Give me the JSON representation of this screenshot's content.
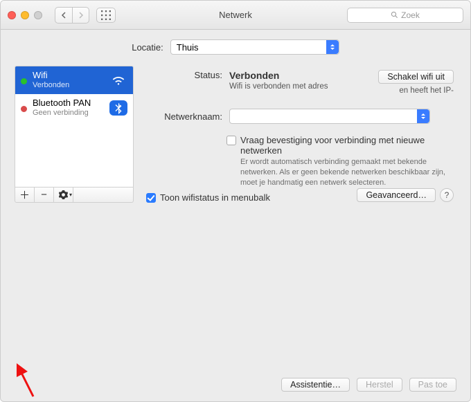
{
  "window": {
    "title": "Netwerk"
  },
  "search": {
    "placeholder": "Zoek"
  },
  "location": {
    "label": "Locatie:",
    "value": "Thuis"
  },
  "services": [
    {
      "name": "Wifi",
      "status": "Verbonden",
      "dot": "green",
      "icon": "wifi",
      "selected": true
    },
    {
      "name": "Bluetooth PAN",
      "status": "Geen verbinding",
      "dot": "red",
      "icon": "bt",
      "selected": false
    }
  ],
  "detail": {
    "status_label": "Status:",
    "status_value": "Verbonden",
    "turn_off_label": "Schakel wifi uit",
    "status_sub1": "Wifi is verbonden met adres",
    "status_sub2": "en heeft het IP-",
    "netname_label": "Netwerknaam:",
    "netname_value": "",
    "ask_label": "Vraag bevestiging voor verbinding met nieuwe netwerken",
    "ask_desc": "Er wordt automatisch verbinding gemaakt met bekende netwerken. Als er geen bekende netwerken beschikbaar zijn, moet je handmatig een netwerk selecteren.",
    "show_menubar_label": "Toon wifistatus in menubalk",
    "advanced_label": "Geavanceerd…"
  },
  "footer": {
    "assist": "Assistentie…",
    "revert": "Herstel",
    "apply": "Pas toe"
  }
}
